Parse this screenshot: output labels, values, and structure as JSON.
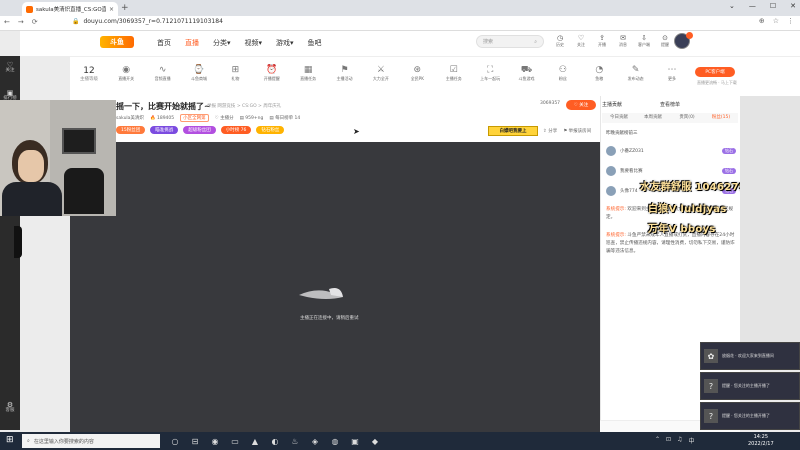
{
  "browser": {
    "tab_title": "sakula美清炽直播_CS:GO直播...",
    "tab_close": "×",
    "new_tab": "+",
    "window_buttons": [
      "⌄",
      "—",
      "☐",
      "✕"
    ],
    "nav": [
      "←",
      "→",
      "⟳"
    ],
    "url": "douyu.com/3069357_r=0.7121071119103184",
    "url_lock": "🔒",
    "right_icons": [
      "⊕",
      "☆",
      "⋮"
    ]
  },
  "rail": {
    "items": [
      {
        "icon": "♡",
        "label": "关注"
      },
      {
        "icon": "▣",
        "label": "排行榜"
      },
      {
        "icon": "⚙",
        "label": "客服"
      }
    ]
  },
  "header": {
    "logo": "斗鱼",
    "nav": [
      {
        "label": "首页",
        "active": false
      },
      {
        "label": "直播",
        "active": true
      },
      {
        "label": "分类▾",
        "active": false
      },
      {
        "label": "视频▾",
        "active": false
      },
      {
        "label": "游戏▾",
        "active": false
      },
      {
        "label": "鱼吧",
        "active": false
      }
    ],
    "search_placeholder": "搜索",
    "search_icon": "⌕",
    "icons": [
      {
        "glyph": "◷",
        "label": "历史"
      },
      {
        "glyph": "♡",
        "label": "关注"
      },
      {
        "glyph": "⇪",
        "label": "开播"
      },
      {
        "glyph": "✉",
        "label": "消息"
      },
      {
        "glyph": "⇩",
        "label": "客户端"
      },
      {
        "glyph": "⊙",
        "label": "提醒"
      }
    ]
  },
  "toolbar": {
    "level_number": "12",
    "level_label": "主播等级",
    "tools": [
      {
        "glyph": "◉",
        "label": "直播开关"
      },
      {
        "glyph": "∿",
        "label": "音频直播"
      },
      {
        "glyph": "⌚",
        "label": "斗鱼商城"
      },
      {
        "glyph": "⊞",
        "label": "礼物"
      },
      {
        "glyph": "⏰",
        "label": "开播提醒"
      },
      {
        "glyph": "▦",
        "label": "直播任务"
      },
      {
        "glyph": "⚑",
        "label": "主播活动"
      },
      {
        "glyph": "⚔",
        "label": "大力全开"
      },
      {
        "glyph": "⊛",
        "label": "全民PK"
      },
      {
        "glyph": "☑",
        "label": "主播任务"
      },
      {
        "glyph": "⛶",
        "label": "上车一起玩"
      },
      {
        "glyph": "⛟",
        "label": "斗鱼游戏"
      },
      {
        "glyph": "⚇",
        "label": "粉丝"
      },
      {
        "glyph": "◔",
        "label": "鱼粮"
      },
      {
        "glyph": "✎",
        "label": "发布动态"
      },
      {
        "glyph": "⋯",
        "label": "更多"
      }
    ],
    "pc_button": "PC客户端",
    "pc_sub": "直播更流畅 · 马上下载"
  },
  "room": {
    "title": "摇一下，比赛开始就摇了~",
    "tags": "举报  网游竞技 > CS:GO > 周年庆礼",
    "streamer": "sakula美清炽",
    "heat": "🔥 189405",
    "rank_tag": "小区全网第",
    "follows": "♡ 主播分",
    "fans": "▤ 959+ng",
    "extra": "▤ 每日榜单 14",
    "room_id": "3069357",
    "follow_button": "♡ 关注",
    "badges": [
      {
        "label": "15粉丝团",
        "color": "#ff7a3c"
      },
      {
        "label": "瞄准挑战",
        "color": "#7b4be0"
      },
      {
        "label": "超级粉丝团",
        "color": "#b24fe0"
      },
      {
        "label": "小时榜 76",
        "color": "#ff5d23"
      },
      {
        "label": "钻石粉丝",
        "color": "#ffb300"
      }
    ],
    "banner": "白嫖吧我要上",
    "share": "⇪ 分享",
    "report": "⚑ 举报该房间"
  },
  "player": {
    "status": "主播正在连接中，请稍后重试"
  },
  "right_panel": {
    "tab_top_left": "主播贡献",
    "tab_top_right": "查看榜单",
    "tabs": [
      {
        "label": "今日贡献",
        "active": false
      },
      {
        "label": "本周贡献",
        "active": false
      },
      {
        "label": "贵宾(0)",
        "active": false
      },
      {
        "label": "粉丝(15)",
        "active": true
      }
    ],
    "honor_title": "昨晚贡献榜前三",
    "ranks": [
      {
        "name": "小番ZZ031",
        "level": "钻石"
      },
      {
        "name": "我要看比赛",
        "level": "钻石"
      },
      {
        "name": "头像774",
        "level": "钻石"
      }
    ],
    "overlay_lines": [
      "水友群舒服 1046279188",
      "白狼V  luldjyas",
      "万年V  bboys"
    ],
    "sys_tag": "系统提示:",
    "sys1": "欢迎来到主播直播间，请文明发言，注意遵守社区规定。",
    "sys2": "斗鱼严禁未成年人直播或打赏，直播内容存在24小时巡查，禁止传播违规内容，请理性消费，切勿私下交易，谨防诈骗等违法信息。"
  },
  "notifications": [
    {
      "icon": "✿",
      "text": "放烟花 · 欢迎大家来到直播间"
    },
    {
      "icon": "?",
      "text": "提醒 · 您关注的主播开播了"
    },
    {
      "icon": "?",
      "text": "提醒 · 您关注的主播开播了"
    }
  ],
  "taskbar": {
    "start": "⊞",
    "search_placeholder": "在这里输入你要搜索的内容",
    "search_icon": "⌕",
    "apps": [
      "○",
      "⊟",
      "◉",
      "▭",
      "▲",
      "◐",
      "♨",
      "◈",
      "◍",
      "▣",
      "◆"
    ],
    "tray": [
      "⌃",
      "⊡",
      "♫",
      "中"
    ],
    "time": "14:25",
    "date": "2022/2/17"
  }
}
